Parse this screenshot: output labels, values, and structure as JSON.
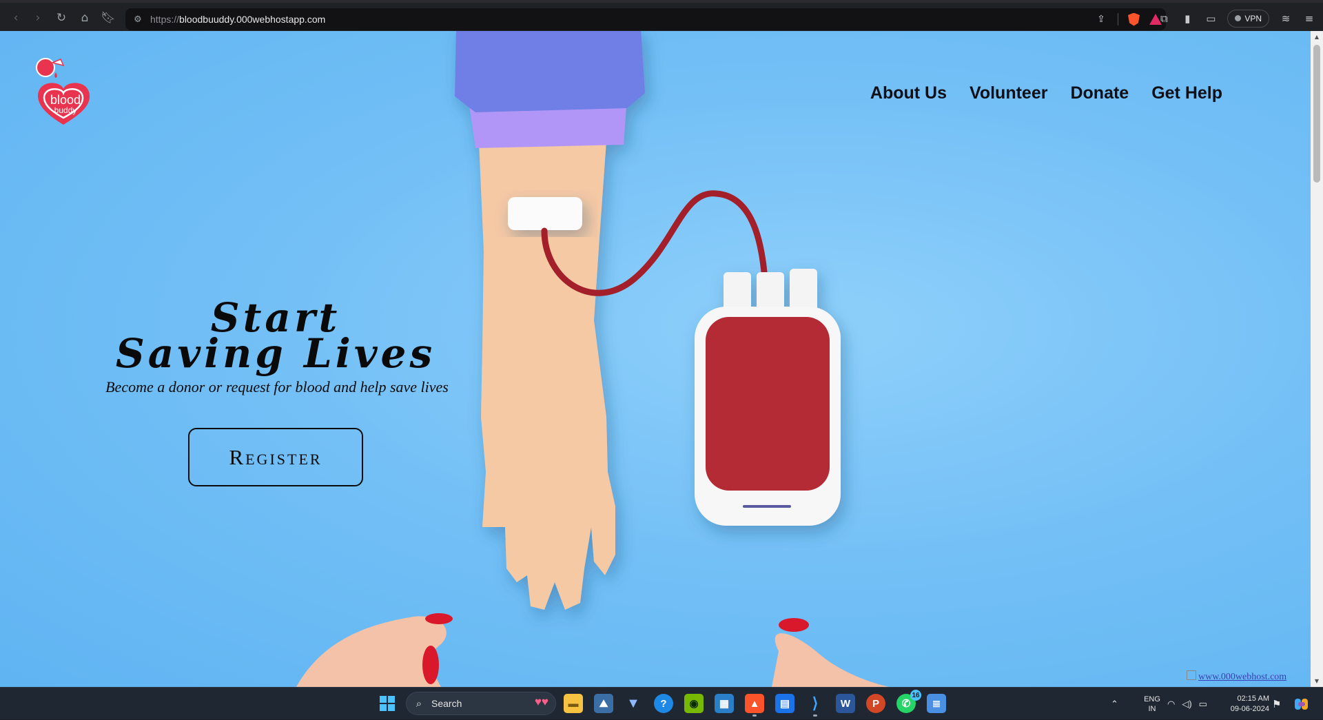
{
  "browser": {
    "url_protocol": "https://",
    "url_host": "bloodbuuddy.000webhostapp.com",
    "vpn_label": "VPN"
  },
  "site": {
    "logo": {
      "line1": "blood",
      "line2": "buddy"
    },
    "nav": [
      "About Us",
      "Volunteer",
      "Donate",
      "Get Help"
    ],
    "hero": {
      "title_line1": "Start",
      "title_line2": "Saving Lives",
      "subtitle": "Become a donor or request for blood and help save lives",
      "cta": "Register"
    },
    "host_badge": "www.000webhost.com"
  },
  "taskbar": {
    "search_label": "Search",
    "whatsapp_badge": "16",
    "lang_line1": "ENG",
    "lang_line2": "IN",
    "time": "02:15 AM",
    "date": "09-06-2024"
  },
  "colors": {
    "page_bg": "#74c0f6",
    "brand_red": "#e8344e",
    "blood_red": "#b42a36",
    "sleeve_blue": "#6f7fe6",
    "sleeve_purple": "#b296f7",
    "skin": "#f6c9a5"
  }
}
